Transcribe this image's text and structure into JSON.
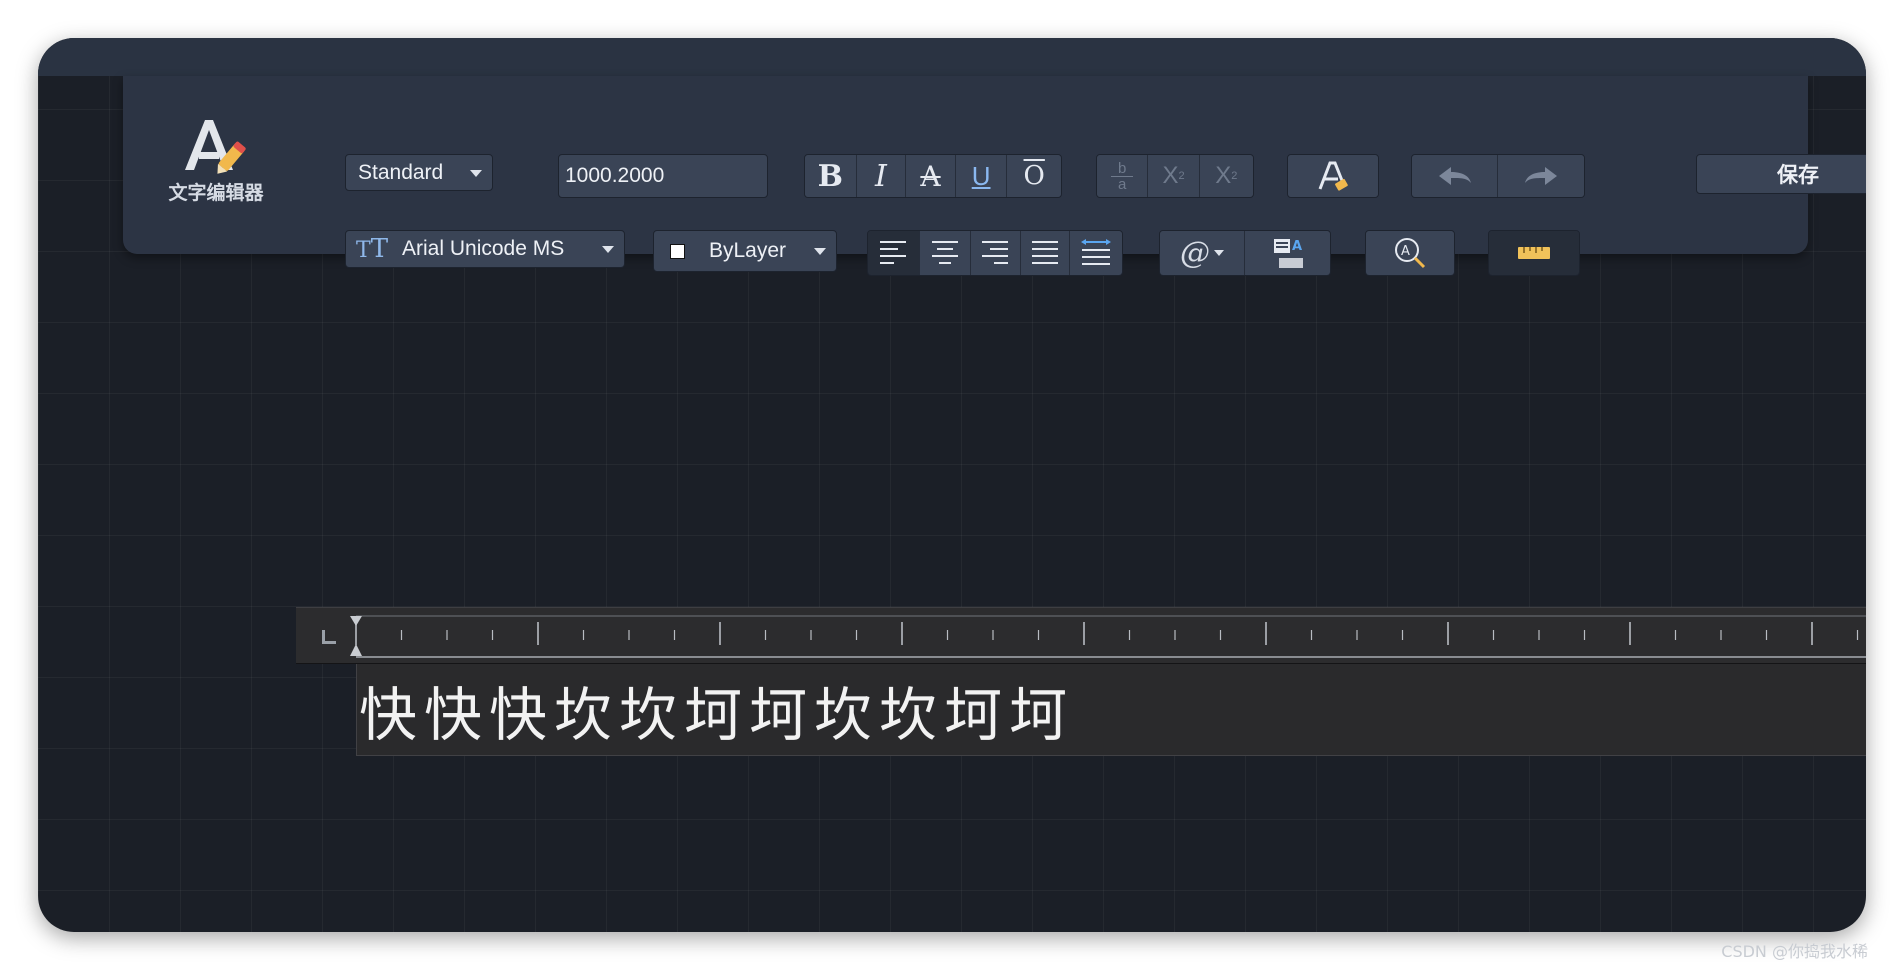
{
  "app": {
    "logo_label": "文字编辑器"
  },
  "toolbar": {
    "style_select": {
      "value": "Standard"
    },
    "height_input": {
      "value": "1000.2000"
    },
    "font_select": {
      "value": "Arial Unicode MS"
    },
    "color_select": {
      "value": "ByLayer",
      "swatch_color": "#ffffff"
    },
    "format_buttons": [
      {
        "name": "bold",
        "glyph": "B"
      },
      {
        "name": "italic",
        "glyph": "I"
      },
      {
        "name": "strikethrough",
        "glyph": "A"
      },
      {
        "name": "underline",
        "glyph": "U"
      },
      {
        "name": "overline",
        "glyph": "O"
      }
    ],
    "stack_buttons": [
      {
        "name": "stack-fraction",
        "top": "b",
        "bottom": "a"
      },
      {
        "name": "superscript",
        "glyph": "X",
        "sub": "2"
      },
      {
        "name": "subscript",
        "glyph": "X",
        "sub": "2"
      }
    ],
    "symbol_button": {
      "glyph": "@"
    },
    "save_label": "保存"
  },
  "editor": {
    "text": "快快快坎坎坷坷坎坎坷坷"
  },
  "watermark": "CSDN @你捣我水稀"
}
